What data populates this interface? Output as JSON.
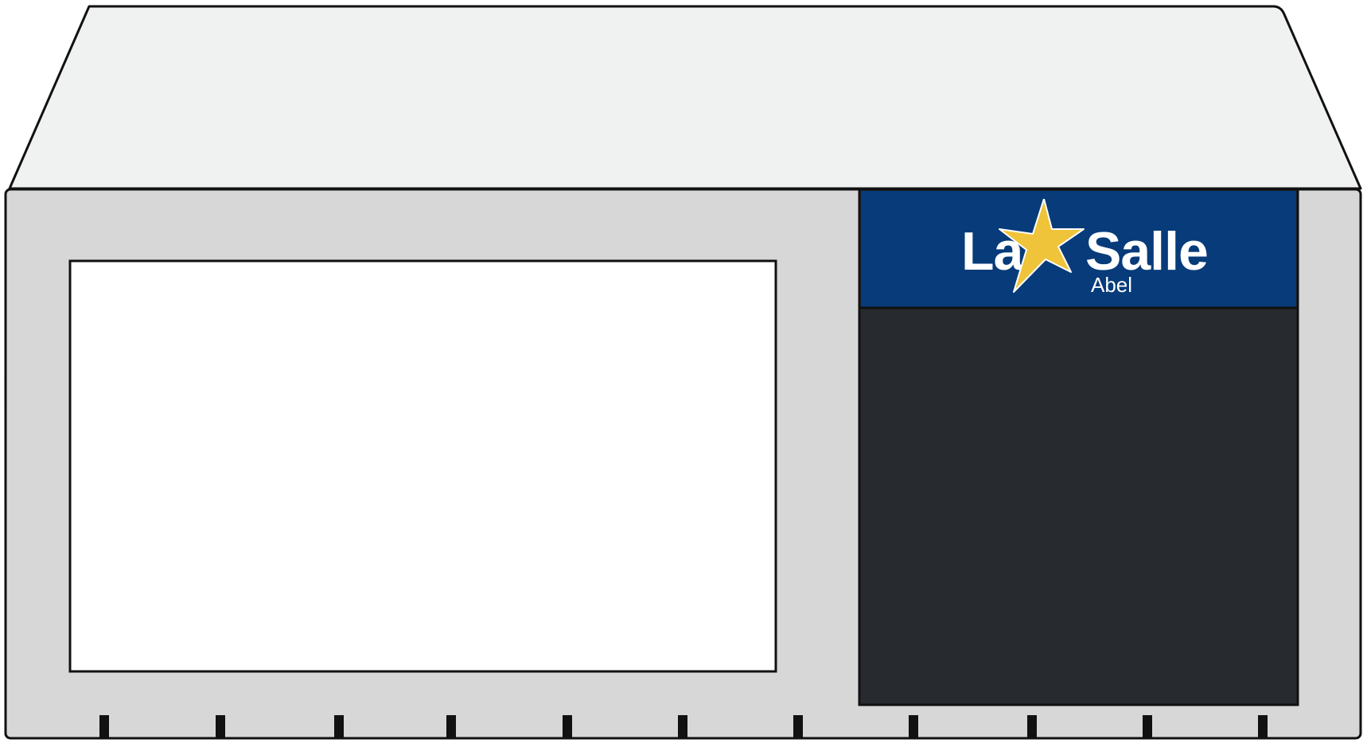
{
  "logo": {
    "word_left": "La",
    "word_right": "Salle",
    "subtitle": "Abel",
    "icon": "star-icon"
  },
  "colors": {
    "roof": "#f0f1f1",
    "front": "#d7d7d7",
    "outline": "#111111",
    "window": "#ffffff",
    "sign_band": "#073b7a",
    "door": "#272a2e",
    "star": "#efc43a",
    "logo_text": "#ffffff"
  },
  "front_marks": 11
}
